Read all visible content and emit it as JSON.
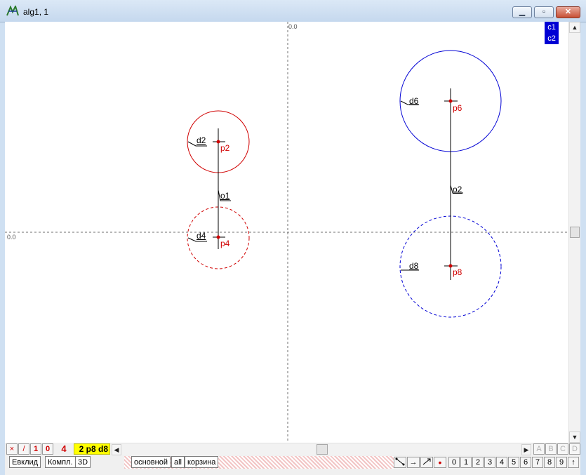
{
  "window": {
    "title": "alg1, 1"
  },
  "canvas": {
    "axis_label_x": "0.0",
    "axis_label_y": "0.0",
    "layers": [
      "c1",
      "c2"
    ],
    "labels": {
      "d2": "d2",
      "p2": "p2",
      "o1": "o1",
      "d4": "d4",
      "p4": "p4",
      "d6": "d6",
      "p6": "p6",
      "o2": "o2",
      "d8": "d8",
      "p8": "p8"
    },
    "colors": {
      "red": "#d00000",
      "blue": "#0000d4",
      "axis": "#6f6f6f"
    }
  },
  "toolbar": {
    "x_button": "×",
    "slash_button": "/",
    "one_button": "1",
    "zero_button": "0",
    "count": "4",
    "selection": "2 p8 d8"
  },
  "tabs_left": [
    "Евклид",
    "Компл.",
    "3D"
  ],
  "tabs_mid": [
    "основной",
    "all",
    "корзина"
  ],
  "letter_buttons": [
    "A",
    "B",
    "C",
    "D"
  ],
  "digit_buttons": [
    "0",
    "1",
    "2",
    "3",
    "4",
    "5",
    "6",
    "7",
    "8",
    "9",
    "↑"
  ],
  "tool_icons": [
    "→",
    "•"
  ]
}
